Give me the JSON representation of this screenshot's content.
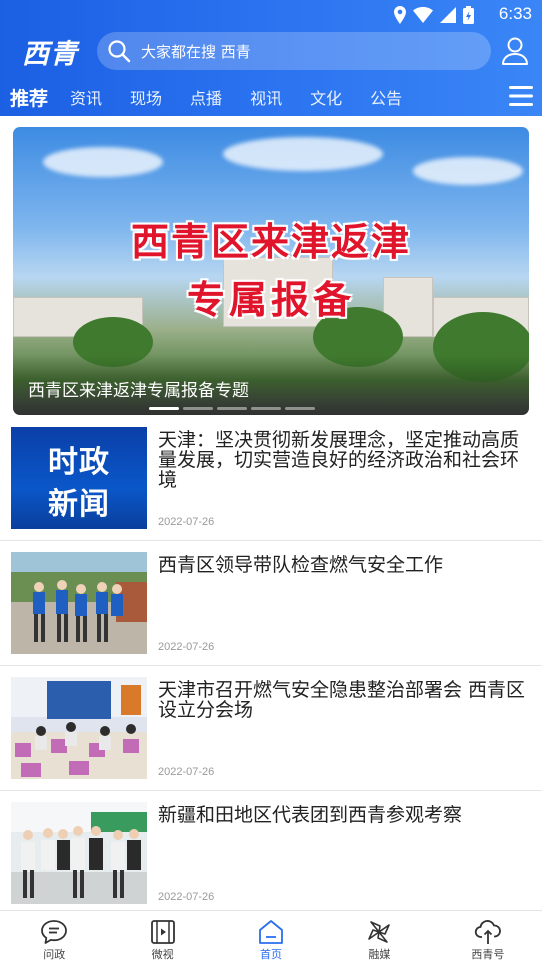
{
  "status_bar": {
    "time": "6:33"
  },
  "header": {
    "logo": "西青",
    "search_placeholder": "大家都在搜 西青"
  },
  "tabs": [
    "推荐",
    "资讯",
    "现场",
    "点播",
    "视讯",
    "文化",
    "公告"
  ],
  "banner": {
    "headline_line1": "西青区来津返津",
    "headline_line2": "专属报备",
    "caption": "西青区来津返津专属报备专题",
    "slide_count": 5,
    "active_slide": 1
  },
  "news": [
    {
      "thumb_text_1": "时政",
      "thumb_text_2": "新闻",
      "title": "天津：坚决贯彻新发展理念，坚定推动高质量发展，切实营造良好的经济政治和社会环境",
      "date": "2022-07-26"
    },
    {
      "title": "西青区领导带队检查燃气安全工作",
      "date": "2022-07-26"
    },
    {
      "title": "天津市召开燃气安全隐患整治部署会 西青区设立分会场",
      "date": "2022-07-26"
    },
    {
      "title": "新疆和田地区代表团到西青参观考察",
      "date": "2022-07-26"
    }
  ],
  "bottom_nav": [
    {
      "label": "问政",
      "icon": "chat-icon"
    },
    {
      "label": "微视",
      "icon": "video-icon"
    },
    {
      "label": "首页",
      "icon": "home-icon",
      "active": true
    },
    {
      "label": "融媒",
      "icon": "pinwheel-icon"
    },
    {
      "label": "西青号",
      "icon": "cloud-upload-icon"
    }
  ],
  "colors": {
    "header_blue": "#2b6df0",
    "active_nav": "#2b6df0",
    "headline_red": "#e0142a"
  }
}
